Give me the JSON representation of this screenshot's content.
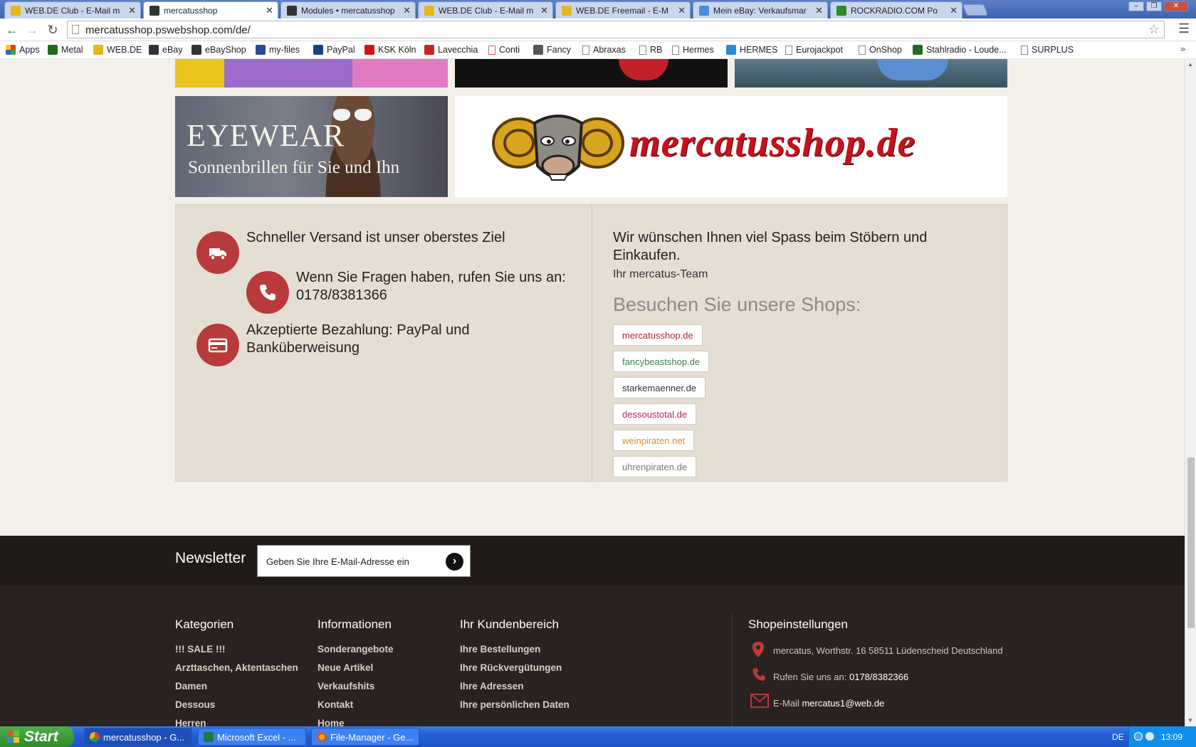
{
  "browser": {
    "tabs": [
      {
        "label": "WEB.DE Club - E-Mail m"
      },
      {
        "label": "mercatusshop"
      },
      {
        "label": "Modules • mercatusshop"
      },
      {
        "label": "WEB.DE Club - E-Mail m"
      },
      {
        "label": "WEB.DE Freemail - E-M"
      },
      {
        "label": "Mein eBay: Verkaufsmar"
      },
      {
        "label": "ROCKRADIO.COM Po"
      }
    ],
    "url": "mercatusshop.pswebshop.com/de/",
    "bookmarks": [
      {
        "label": "Apps"
      },
      {
        "label": "Metal"
      },
      {
        "label": "WEB.DE"
      },
      {
        "label": "eBay"
      },
      {
        "label": "eBayShop"
      },
      {
        "label": "my-files"
      },
      {
        "label": "PayPal"
      },
      {
        "label": "KSK Köln"
      },
      {
        "label": "Lavecchia"
      },
      {
        "label": "Conti"
      },
      {
        "label": "Fancy"
      },
      {
        "label": "Abraxas"
      },
      {
        "label": "RB"
      },
      {
        "label": "Hermes"
      },
      {
        "label": "HERMES"
      },
      {
        "label": "Eurojackpot"
      },
      {
        "label": "OnShop"
      },
      {
        "label": "Stahlradio - Loude..."
      },
      {
        "label": "SURPLUS"
      }
    ],
    "bookmarks_more": "»"
  },
  "banners": {
    "eyewear_title": "EYEWEAR",
    "eyewear_subtitle": "Sonnenbrillen für Sie und Ihn",
    "logo_text": "mercatusshop.de"
  },
  "info": {
    "shipping": "Schneller Versand ist unser oberstes Ziel",
    "phone": "Wenn Sie Fragen haben, rufen Sie uns an: 0178/8381366",
    "payment": "Akzeptierte Bezahlung: PayPal und Banküberweisung",
    "welcome": "Wir wünschen Ihnen viel Spass beim Stöbern und Einkaufen.",
    "team": "Ihr mercatus-Team",
    "shops_title": "Besuchen Sie unsere Shops:",
    "shops": [
      {
        "label": "mercatusshop.de",
        "color": "#b3262f"
      },
      {
        "label": "fancybeastshop.de",
        "color": "#3f7f4e"
      },
      {
        "label": "starkemaenner.de",
        "color": "#333333"
      },
      {
        "label": "dessoustotal.de",
        "color": "#c2185b"
      },
      {
        "label": "weinpiraten.net",
        "color": "#e08a2c"
      },
      {
        "label": "uhrenpiraten.de",
        "color": "#777777"
      }
    ]
  },
  "newsletter": {
    "title": "Newsletter",
    "placeholder": "Geben Sie Ihre E-Mail-Adresse ein"
  },
  "footer": {
    "kategorien": {
      "title": "Kategorien",
      "items": [
        "!!! SALE !!!",
        "Arzttaschen, Aktentaschen",
        "Damen",
        "Dessous",
        "Herren"
      ]
    },
    "informationen": {
      "title": "Informationen",
      "items": [
        "Sonderangebote",
        "Neue Artikel",
        "Verkaufshits",
        "Kontakt",
        "Home"
      ]
    },
    "kundenbereich": {
      "title": "Ihr Kundenbereich",
      "items": [
        "Ihre Bestellungen",
        "Ihre Rückvergütungen",
        "Ihre Adressen",
        "Ihre persönlichen Daten"
      ]
    },
    "shopeinstellungen": {
      "title": "Shopeinstellungen",
      "address": "mercatus, Worthstr. 16 58511 Lüdenscheid Deutschland",
      "phone_label": "Rufen Sie uns an:",
      "phone": "0178/8382366",
      "email_label": "E-Mail",
      "email": "mercatus1@web.de"
    }
  },
  "taskbar": {
    "start": "Start",
    "tasks": [
      {
        "label": "mercatusshop - G..."
      },
      {
        "label": "Microsoft Excel - ..."
      },
      {
        "label": "File-Manager - Ge..."
      }
    ],
    "lang": "DE",
    "clock": "13:09"
  },
  "colors": {
    "accent": "#b83a3a",
    "info_bg": "#e5ded2",
    "footer_bg": "#2a2220"
  }
}
